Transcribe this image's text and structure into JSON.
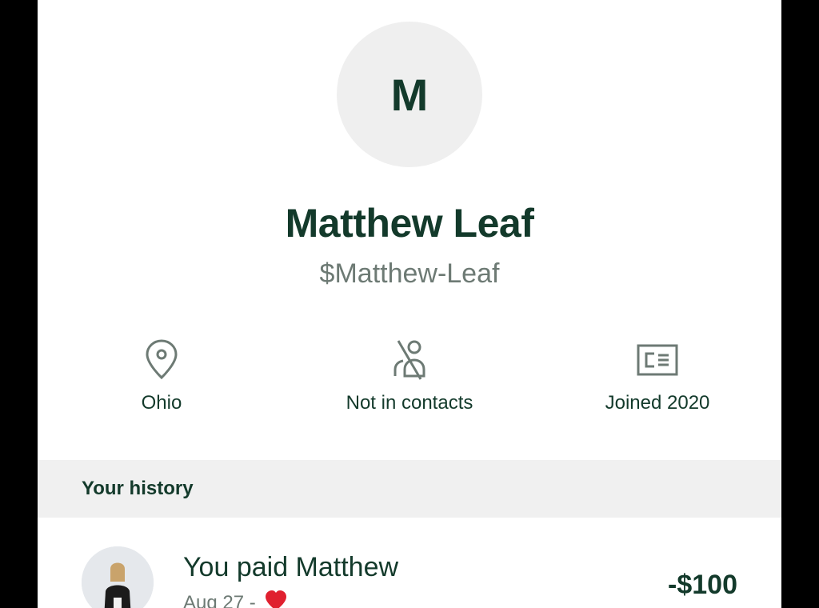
{
  "profile": {
    "avatar_initial": "M",
    "name": "Matthew Leaf",
    "cashtag": "$Matthew-Leaf",
    "info": [
      {
        "icon": "location-pin-icon",
        "label": "Ohio"
      },
      {
        "icon": "no-contact-icon",
        "label": "Not in contacts"
      },
      {
        "icon": "id-card-icon",
        "label": "Joined 2020"
      }
    ]
  },
  "history": {
    "title": "Your history",
    "items": [
      {
        "title": "You paid Matthew",
        "subtitle": "Aug 27 -",
        "reaction_icon": "heart-icon",
        "amount": "-$100"
      }
    ]
  },
  "colors": {
    "primary_text": "#133a2b",
    "secondary_text": "#6d7a74",
    "section_bg": "#f0f0f0",
    "avatar_bg": "#efefef",
    "heart": "#e0202f"
  }
}
